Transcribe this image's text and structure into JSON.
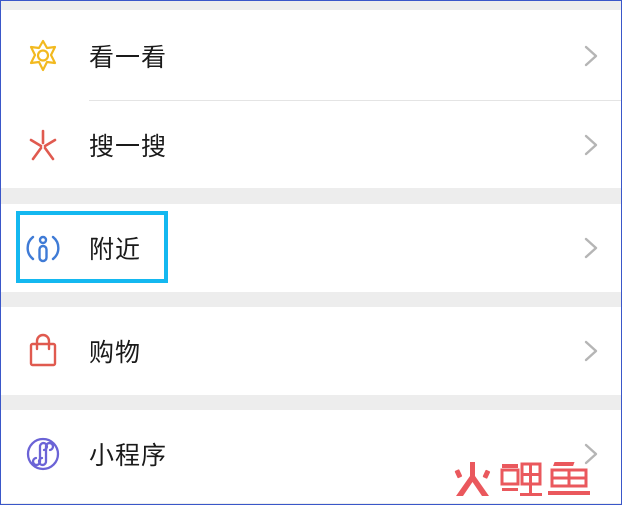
{
  "menu": {
    "items": [
      {
        "label": "看一看",
        "icon": "look-icon",
        "color": "#f2b91f"
      },
      {
        "label": "搜一搜",
        "icon": "search-sparkle-icon",
        "color": "#e05a4f"
      },
      {
        "label": "附近",
        "icon": "nearby-person-icon",
        "color": "#3f7bd6"
      },
      {
        "label": "购物",
        "icon": "shopping-bag-icon",
        "color": "#e05a4f"
      },
      {
        "label": "小程序",
        "icon": "mini-program-icon",
        "color": "#6b63d6"
      }
    ]
  },
  "highlight": {
    "target": "附近",
    "color": "#14b8f0"
  },
  "watermark": {
    "logo_text": "火鲤鱼"
  }
}
